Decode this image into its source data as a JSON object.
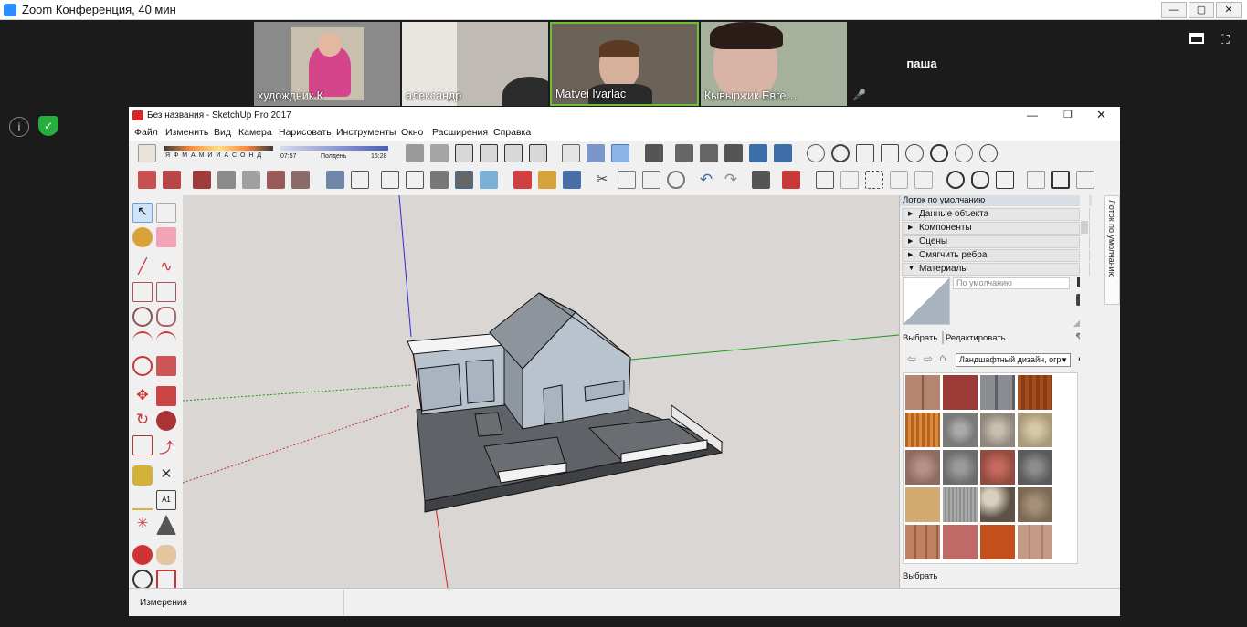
{
  "zoom": {
    "title": "Zoom Конференция, 40 мин",
    "participants": [
      {
        "name": "худождник.К"
      },
      {
        "name": "александр"
      },
      {
        "name": "Matvei Ivarlac"
      },
      {
        "name": "Кывыржик Евге…"
      },
      {
        "name": "паша"
      }
    ],
    "colors": {
      "zoom_blue": "#2d8cff",
      "active_speaker": "#6dbf3b",
      "shield_green": "#27ae3c"
    }
  },
  "sketchup": {
    "title": "Без названия - SketchUp Pro 2017",
    "menu": [
      "Файл",
      "Изменить",
      "Вид",
      "Камера",
      "Нарисовать",
      "Инструменты",
      "Окно",
      "Расширения",
      "Справка"
    ],
    "shadow_months": "Я Ф М А М И И А С О Н Д",
    "time_start": "07:57",
    "time_mid": "Полдень",
    "time_end": "16:28",
    "tray": {
      "title": "Лоток по умолчанию",
      "side_tab": "Лоток по умолчанию",
      "sections": [
        "Данные объекта",
        "Компоненты",
        "Сцены",
        "Смягчить ребра",
        "Материалы"
      ],
      "material_name": "По умолчанию",
      "tabs": [
        "Выбрать",
        "Редактировать"
      ],
      "library": "Ландшафтный дизайн, огр",
      "footer": "Выбрать"
    },
    "status_label": "Измерения"
  }
}
